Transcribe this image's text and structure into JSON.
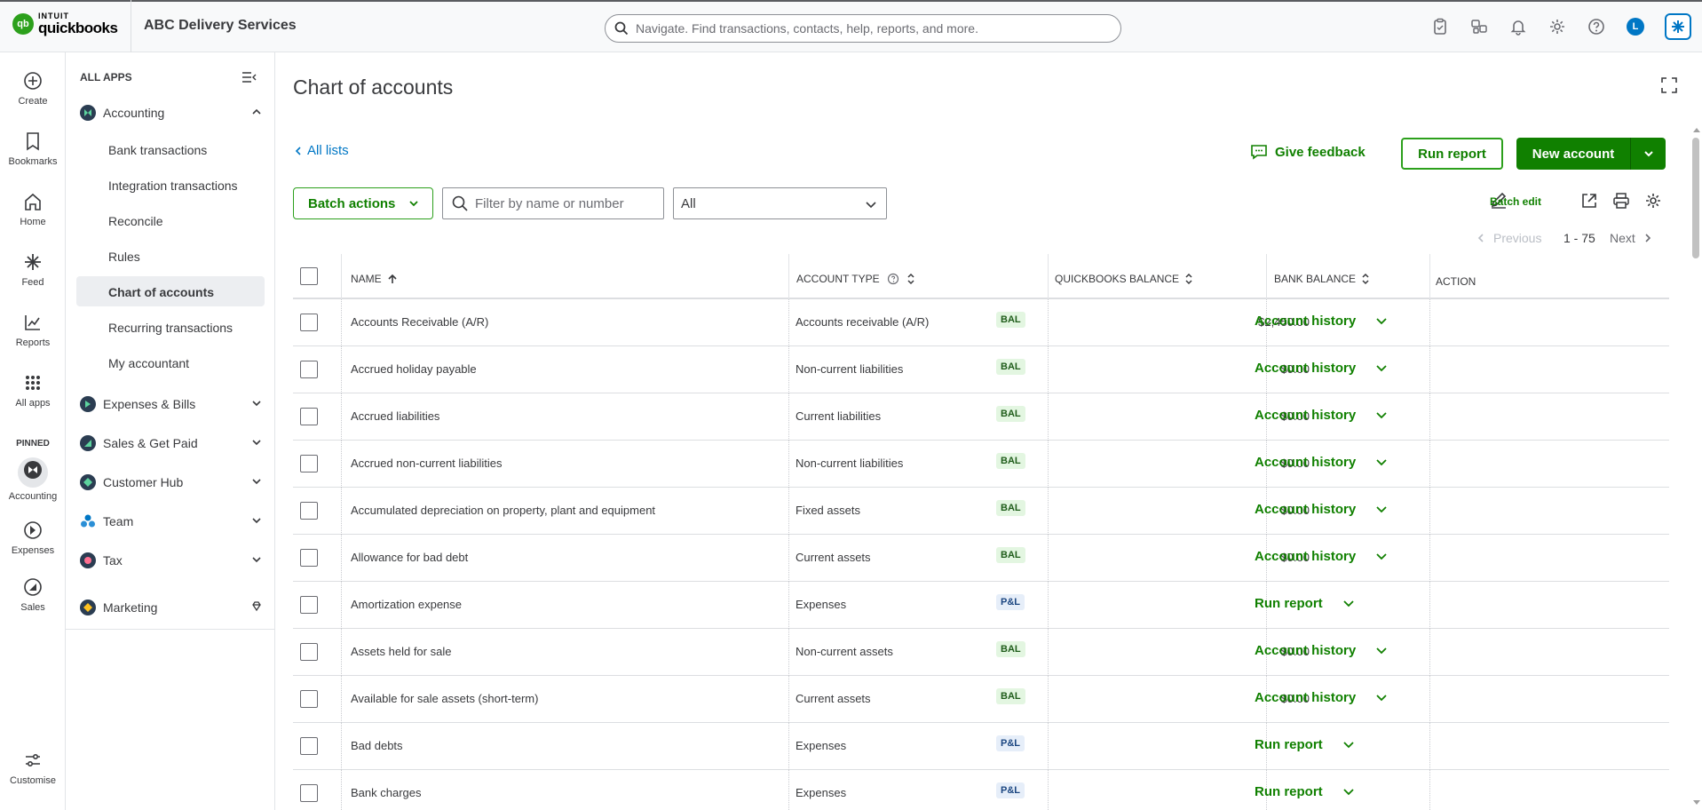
{
  "topbar": {
    "brand_top": "INTUIT",
    "brand_bottom": "quickbooks",
    "logo_mark": "qb",
    "company": "ABC Delivery Services",
    "search_placeholder": "Navigate. Find transactions, contacts, help, reports, and more.",
    "avatar_letter": "L",
    "icons": [
      "clipboard-icon",
      "apps-switch-icon",
      "bell-icon",
      "gear-icon",
      "help-icon"
    ]
  },
  "rail": {
    "items": [
      {
        "label": "Create",
        "icon": "plus-circle-icon"
      },
      {
        "label": "Bookmarks",
        "icon": "bookmark-icon"
      },
      {
        "label": "Home",
        "icon": "home-icon"
      },
      {
        "label": "Feed",
        "icon": "feed-icon"
      },
      {
        "label": "Reports",
        "icon": "chart-icon"
      },
      {
        "label": "All apps",
        "icon": "grid-icon"
      }
    ],
    "pinned_label": "PINNED",
    "pinned": [
      {
        "label": "Accounting",
        "icon": "accounting-icon"
      },
      {
        "label": "Expenses",
        "icon": "expenses-icon"
      },
      {
        "label": "Sales",
        "icon": "sales-icon"
      }
    ],
    "customise": "Customise"
  },
  "nav": {
    "heading": "ALL APPS",
    "accounting": {
      "label": "Accounting",
      "items": [
        "Bank transactions",
        "Integration transactions",
        "Reconcile",
        "Rules",
        "Chart of accounts",
        "Recurring transactions",
        "My accountant"
      ],
      "active": "Chart of accounts"
    },
    "groups": [
      "Expenses & Bills",
      "Sales & Get Paid",
      "Customer Hub",
      "Team",
      "Tax"
    ],
    "marketing": "Marketing"
  },
  "main": {
    "title": "Chart of accounts",
    "back_link": "All lists",
    "feedback": "Give feedback",
    "run_report": "Run report",
    "new_account": "New account",
    "batch_actions": "Batch actions",
    "filter_placeholder": "Filter by name or number",
    "type_filter": "All",
    "batch_edit": "Batch edit",
    "pager": {
      "previous": "Previous",
      "range": "1 - 75",
      "next": "Next"
    }
  },
  "table": {
    "headers": {
      "name": "NAME",
      "type": "ACCOUNT TYPE",
      "qb_balance": "QUICKBOOKS BALANCE",
      "bank_balance": "BANK BALANCE",
      "action": "ACTION"
    },
    "rows": [
      {
        "name": "Accounts Receivable (A/R)",
        "type": "Accounts receivable (A/R)",
        "badge": "BAL",
        "balance": "$2,450.00",
        "action": "Account history"
      },
      {
        "name": "Accrued holiday payable",
        "type": "Non-current liabilities",
        "badge": "BAL",
        "balance": "$0.00",
        "action": "Account history"
      },
      {
        "name": "Accrued liabilities",
        "type": "Current liabilities",
        "badge": "BAL",
        "balance": "$0.00",
        "action": "Account history"
      },
      {
        "name": "Accrued non-current liabilities",
        "type": "Non-current liabilities",
        "badge": "BAL",
        "balance": "$0.00",
        "action": "Account history"
      },
      {
        "name": "Accumulated depreciation on property, plant and equipment",
        "type": "Fixed assets",
        "badge": "BAL",
        "balance": "$0.00",
        "action": "Account history"
      },
      {
        "name": "Allowance for bad debt",
        "type": "Current assets",
        "badge": "BAL",
        "balance": "$0.00",
        "action": "Account history"
      },
      {
        "name": "Amortization expense",
        "type": "Expenses",
        "badge": "P&L",
        "balance": "",
        "action": "Run report"
      },
      {
        "name": "Assets held for sale",
        "type": "Non-current assets",
        "badge": "BAL",
        "balance": "$0.00",
        "action": "Account history"
      },
      {
        "name": "Available for sale assets (short-term)",
        "type": "Current assets",
        "badge": "BAL",
        "balance": "$0.00",
        "action": "Account history"
      },
      {
        "name": "Bad debts",
        "type": "Expenses",
        "badge": "P&L",
        "balance": "",
        "action": "Run report"
      },
      {
        "name": "Bank charges",
        "type": "Expenses",
        "badge": "P&L",
        "balance": "",
        "action": "Run report"
      }
    ]
  }
}
